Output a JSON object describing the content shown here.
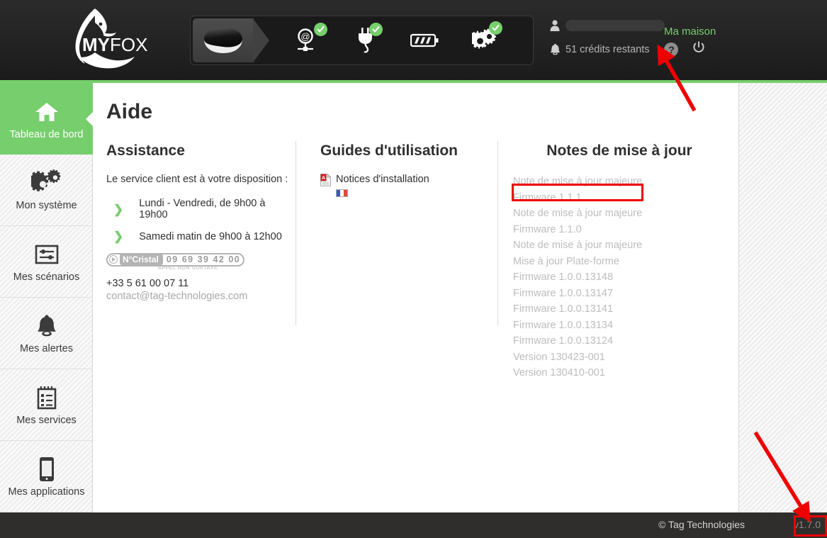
{
  "brand": {
    "logo_text_bold": "MY",
    "logo_text_light": "FOX",
    "logo_icon": "fox-head-icon"
  },
  "topnav": {
    "items": [
      {
        "id": "device",
        "icon": "myfox-device-icon",
        "label": "Centrale",
        "active": true,
        "badge": false
      },
      {
        "id": "network",
        "icon": "at-network-icon",
        "label": "Connexion internet",
        "active": false,
        "badge": true
      },
      {
        "id": "power",
        "icon": "power-plug-icon",
        "label": "Alimentation secteur",
        "active": false,
        "badge": true
      },
      {
        "id": "battery",
        "icon": "battery-icon",
        "label": "Batterie",
        "active": false,
        "badge": false
      },
      {
        "id": "settings",
        "icon": "gear-icon",
        "label": "Configuration",
        "active": false,
        "badge": true
      }
    ]
  },
  "user": {
    "account_icon": "person-icon",
    "account_name": "",
    "site_name": "Ma maison",
    "bell_icon": "bell-icon",
    "credits": "51 crédits restants",
    "help_icon": "question-mark-icon",
    "help_label": "?",
    "logout_icon": "power-off-icon"
  },
  "sidebar": {
    "items": [
      {
        "label": "Tableau de bord",
        "icon": "home-icon",
        "active": true
      },
      {
        "label": "Mon système",
        "icon": "gears-icon",
        "active": false
      },
      {
        "label": "Mes scénarios",
        "icon": "sliders-icon",
        "active": false
      },
      {
        "label": "Mes alertes",
        "icon": "bell-icon",
        "active": false
      },
      {
        "label": "Mes services",
        "icon": "clipboard-icon",
        "active": false
      },
      {
        "label": "Mes applications",
        "icon": "smartphone-icon",
        "active": false
      }
    ]
  },
  "page": {
    "title": "Aide"
  },
  "assistance": {
    "heading": "Assistance",
    "intro": "Le service client est à votre disposition :",
    "hours": [
      "Lundi - Vendredi, de 9h00 à 19h00",
      "Samedi matin de 9h00 à 12h00"
    ],
    "cristal_label": "N°Cristal",
    "cristal_number": "09 69 39 42 00",
    "cristal_note": "APPEL NON SURTAXE",
    "phone_international": "+33 5 61 00 07 11",
    "email": "contact@tag-technologies.com"
  },
  "guides": {
    "heading": "Guides d'utilisation",
    "items": [
      {
        "label": "Notices d'installation",
        "icon": "pdf-file-icon",
        "flag": "french-flag-icon"
      }
    ]
  },
  "releases": {
    "heading": "Notes de mise à jour",
    "items": [
      "Note de mise à jour majeure",
      "Firmware 1.1.1",
      "Note de mise à jour majeure",
      "Firmware 1.1.0",
      "Note de mise à jour majeure",
      "Mise à jour Plate-forme",
      "Firmware 1.0.0.13148",
      "Firmware 1.0.0.13147",
      "Firmware 1.0.0.13141",
      "Firmware 1.0.0.13134",
      "Firmware 1.0.0.13124",
      "Version 130423-001",
      "Version 130410-001"
    ]
  },
  "footer": {
    "copyright": "© Tag Technologies",
    "version": "v1.7.0"
  },
  "colors": {
    "accent_green": "#76ce6c",
    "topbar_dark": "#242424",
    "footer_dark": "#2f2e2c",
    "annotation_red": "#ee0000",
    "muted_text": "#bdbdbd"
  }
}
